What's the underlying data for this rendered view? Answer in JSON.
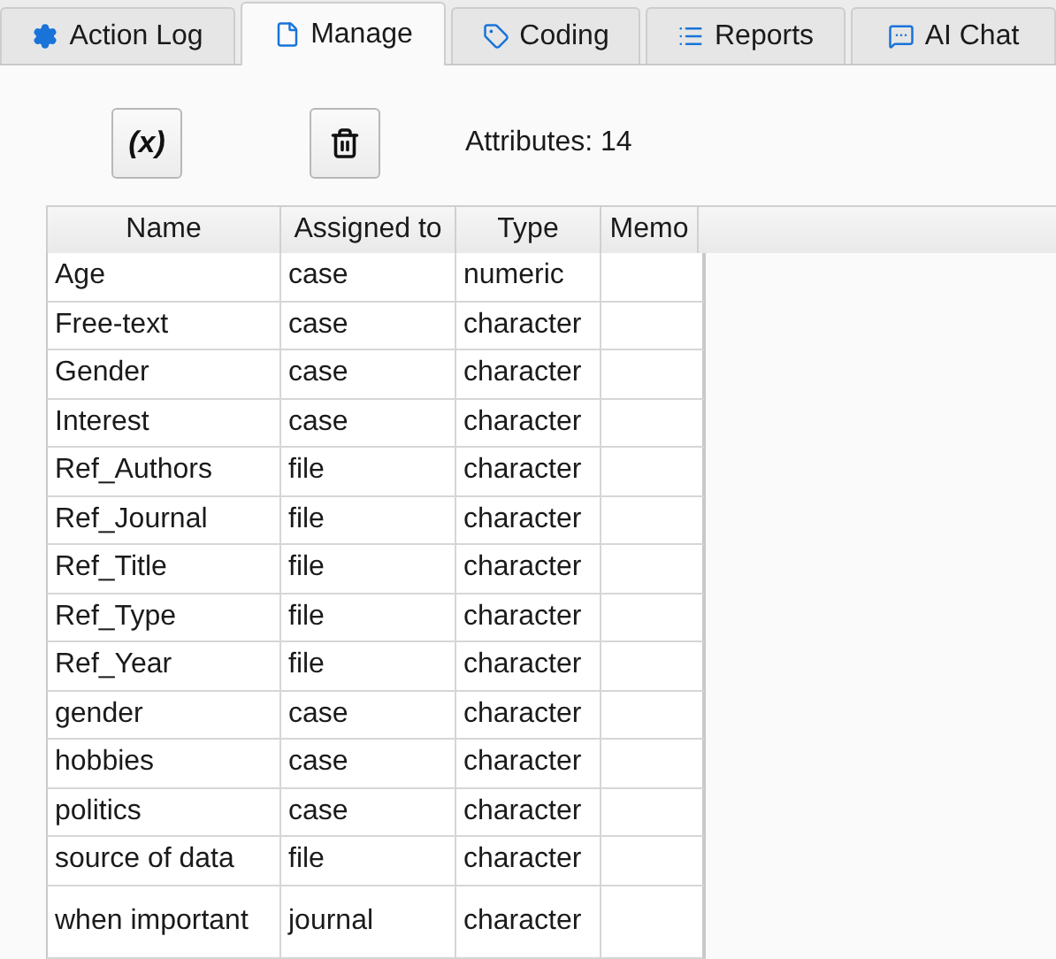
{
  "tabs": [
    {
      "label": "Action Log",
      "kind": "log",
      "selected": false
    },
    {
      "label": "Manage",
      "kind": "manage",
      "selected": true
    },
    {
      "label": "Coding",
      "kind": "coding",
      "selected": false
    },
    {
      "label": "Reports",
      "kind": "reports",
      "selected": false
    },
    {
      "label": "AI Chat",
      "kind": "chat",
      "selected": false
    }
  ],
  "toolbar": {
    "variable_button": "(x)",
    "count_label": "Attributes: 14"
  },
  "table": {
    "columns": [
      "Name",
      "Assigned to",
      "Type",
      "Memo"
    ],
    "rows": [
      [
        "Age",
        "case",
        "numeric",
        ""
      ],
      [
        "Free-text",
        "case",
        "character",
        ""
      ],
      [
        "Gender",
        "case",
        "character",
        ""
      ],
      [
        "Interest",
        "case",
        "character",
        ""
      ],
      [
        "Ref_Authors",
        "file",
        "character",
        ""
      ],
      [
        "Ref_Journal",
        "file",
        "character",
        ""
      ],
      [
        "Ref_Title",
        "file",
        "character",
        ""
      ],
      [
        "Ref_Type",
        "file",
        "character",
        ""
      ],
      [
        "Ref_Year",
        "file",
        "character",
        ""
      ],
      [
        "gender",
        "case",
        "character",
        ""
      ],
      [
        "hobbies",
        "case",
        "character",
        ""
      ],
      [
        "politics",
        "case",
        "character",
        ""
      ],
      [
        "source of data",
        "file",
        "character",
        ""
      ],
      [
        "when important",
        "journal",
        "character",
        ""
      ]
    ]
  }
}
